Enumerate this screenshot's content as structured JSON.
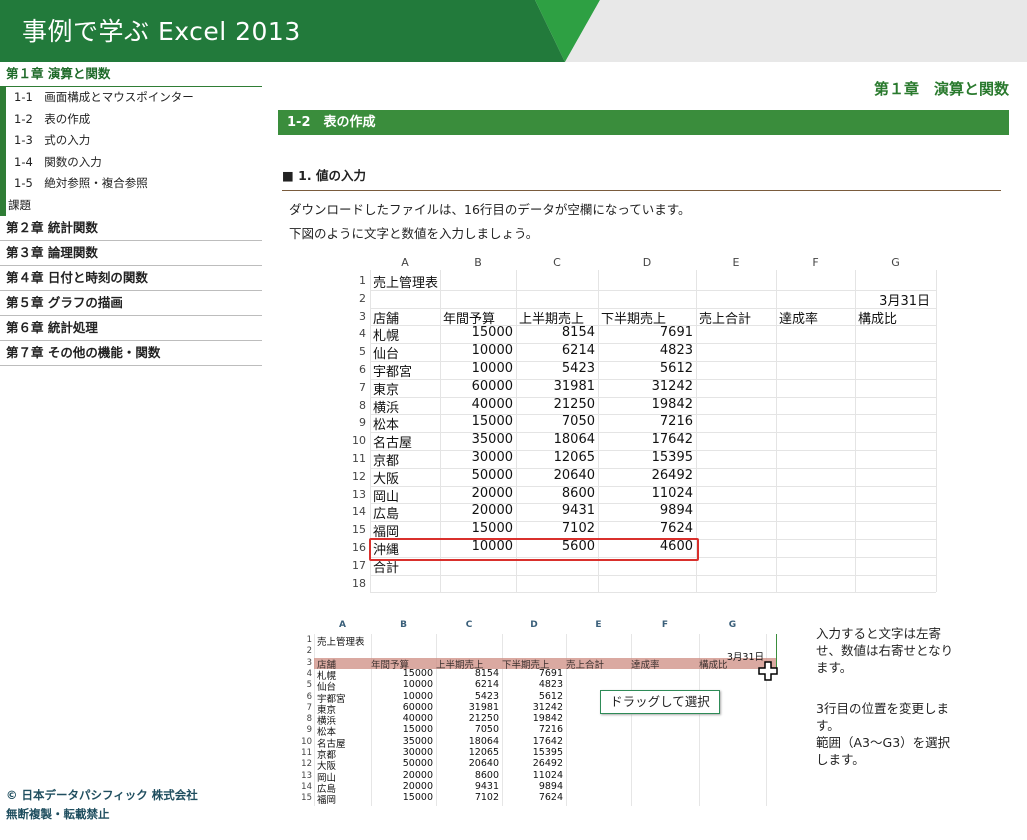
{
  "header": {
    "title": "事例で学ぶ Excel 2013"
  },
  "sidebar": {
    "chapters": [
      {
        "label": "第１章 演算と関数"
      },
      {
        "label": "第２章 統計関数"
      },
      {
        "label": "第３章 論理関数"
      },
      {
        "label": "第４章 日付と時刻の関数"
      },
      {
        "label": "第５章 グラフの描画"
      },
      {
        "label": "第６章 統計処理"
      },
      {
        "label": "第７章 その他の機能・関数"
      }
    ],
    "sub_items": [
      {
        "label": "1-1　画面構成とマウスポインター"
      },
      {
        "label": "1-2　表の作成"
      },
      {
        "label": "1-3　式の入力"
      },
      {
        "label": "1-4　関数の入力"
      },
      {
        "label": "1-5　絶対参照・複合参照"
      },
      {
        "label": "課題"
      }
    ],
    "copyright_line1": "© 日本データパシフィック 株式会社",
    "copyright_line2": "無断複製・転載禁止"
  },
  "main": {
    "chapter_heading": "第１章　演算と関数",
    "section_title": "1-2　表の作成",
    "subsection_title": "■ 1. 値の入力",
    "para1": "ダウンロードしたファイルは、16行目のデータが空欄になっています。",
    "para2": "下図のように文字と数値を入力しましょう。",
    "note1": [
      "入力すると文字は左寄",
      "せ、数値は右寄せとなり",
      "ます。"
    ],
    "note2": [
      "3行目の位置を変更しま",
      "す。",
      "範囲（A3～G3）を選択",
      "します。"
    ],
    "drag_tooltip": "ドラッグして選択"
  },
  "sheet": {
    "columns": [
      "A",
      "B",
      "C",
      "D",
      "E",
      "F",
      "G"
    ],
    "title": "売上管理表",
    "date": "3月31日",
    "headers": [
      "店舗",
      "年間予算",
      "上半期売上",
      "下半期売上",
      "売上合計",
      "達成率",
      "構成比"
    ],
    "rows": [
      [
        "札幌",
        "15000",
        "8154",
        "7691"
      ],
      [
        "仙台",
        "10000",
        "6214",
        "4823"
      ],
      [
        "宇都宮",
        "10000",
        "5423",
        "5612"
      ],
      [
        "東京",
        "60000",
        "31981",
        "31242"
      ],
      [
        "横浜",
        "40000",
        "21250",
        "19842"
      ],
      [
        "松本",
        "15000",
        "7050",
        "7216"
      ],
      [
        "名古屋",
        "35000",
        "18064",
        "17642"
      ],
      [
        "京都",
        "30000",
        "12065",
        "15395"
      ],
      [
        "大阪",
        "50000",
        "20640",
        "26492"
      ],
      [
        "岡山",
        "20000",
        "8600",
        "11024"
      ],
      [
        "広島",
        "20000",
        "9431",
        "9894"
      ],
      [
        "福岡",
        "15000",
        "7102",
        "7624"
      ],
      [
        "沖縄",
        "10000",
        "5600",
        "4600"
      ]
    ],
    "total_label": "合計",
    "row_numbers": [
      "1",
      "2",
      "3",
      "4",
      "5",
      "6",
      "7",
      "8",
      "9",
      "10",
      "11",
      "12",
      "13",
      "14",
      "15",
      "16",
      "17",
      "18"
    ]
  },
  "colors": {
    "green": "#2f7d35",
    "highlight_red": "#d9302c"
  }
}
